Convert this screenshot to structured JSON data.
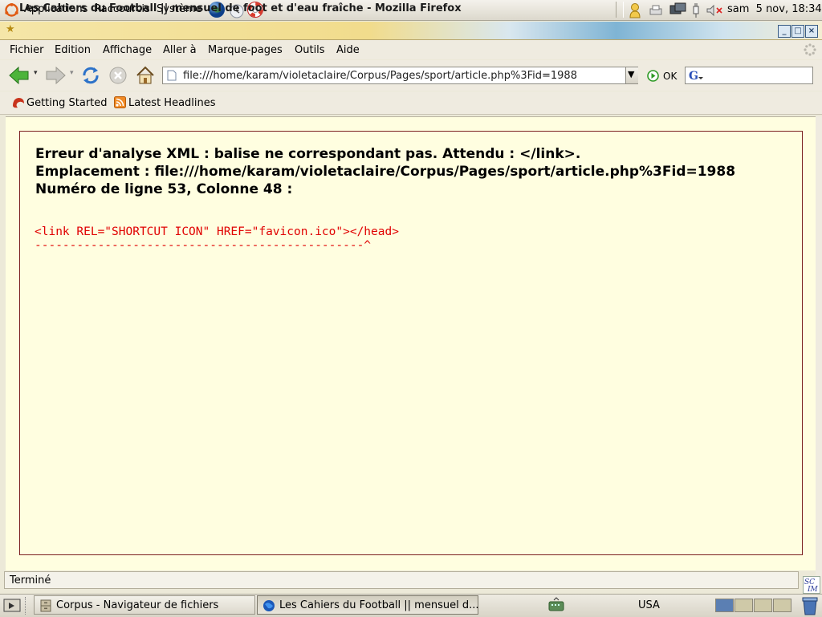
{
  "top_panel": {
    "menus": [
      "Applications",
      "Raccourcis",
      "Système"
    ],
    "clock": "sam  5 nov, 18:34"
  },
  "window": {
    "title": "Les Cahiers du Football || mensuel de foot et d'eau fraîche - Mozilla Firefox",
    "buttons": {
      "minimize": "_",
      "maximize": "□",
      "close": "×"
    }
  },
  "menubar": {
    "items": [
      "Fichier",
      "Edition",
      "Affichage",
      "Aller à",
      "Marque-pages",
      "Outils",
      "Aide"
    ]
  },
  "navbar": {
    "url": "file:///home/karam/violetaclaire/Corpus/Pages/sport/article.php%3Fid=1988",
    "go_label": "OK",
    "search_value": ""
  },
  "bookmarks": {
    "items": [
      "Getting Started",
      "Latest Headlines"
    ]
  },
  "error": {
    "line1": "Erreur d'analyse XML : balise ne correspondant pas. Attendu : </link>.",
    "line2": "Emplacement : file:///home/karam/violetaclaire/Corpus/Pages/sport/article.php%3Fid=1988",
    "line3": "Numéro de ligne 53, Colonne 48 :",
    "source": "<link REL=\"SHORTCUT ICON\" HREF=\"favicon.ico\"></head>",
    "pointer": "-----------------------------------------------^"
  },
  "status": {
    "text": "Terminé"
  },
  "taskbar": {
    "tasks": [
      "Corpus - Navigateur de fichiers",
      "Les Cahiers du Football || mensuel d..."
    ],
    "keyboard": "USA"
  },
  "colors": {
    "content_bg": "#fffee0",
    "error_border": "#7a1f1f",
    "source_red": "#e00000"
  }
}
